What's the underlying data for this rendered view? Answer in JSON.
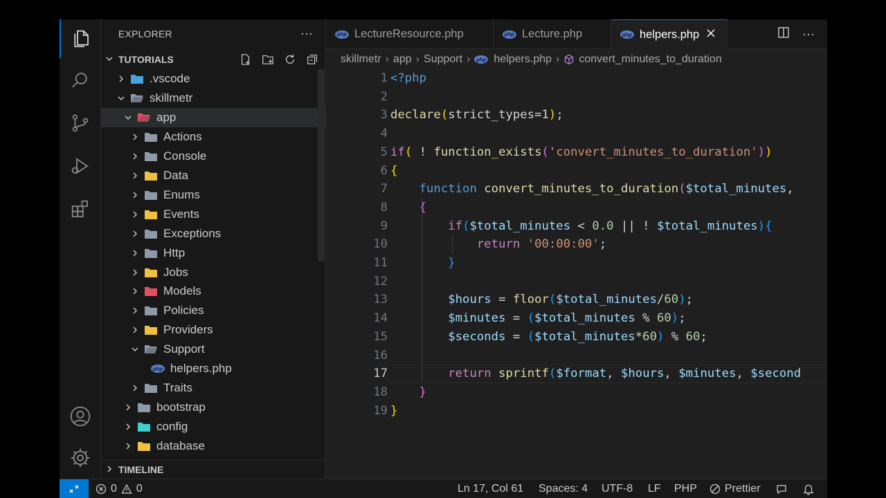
{
  "explorer": {
    "title": "EXPLORER",
    "more": "···",
    "section": "TUTORIALS",
    "timeline": "TIMELINE"
  },
  "tree": [
    {
      "label": ".vscode",
      "depth": 1,
      "open": false,
      "icon": "vscode-folder-icon",
      "color": "#4aa3df"
    },
    {
      "label": "skillmetr",
      "depth": 1,
      "open": true,
      "icon": "folder-open-icon",
      "color": "#8e9aa8"
    },
    {
      "label": "app",
      "depth": 2,
      "open": true,
      "icon": "app-folder-icon",
      "color": "#e05260",
      "selected": true
    },
    {
      "label": "Actions",
      "depth": 3,
      "open": false,
      "icon": "folder-icon",
      "color": "#8e9aa8"
    },
    {
      "label": "Console",
      "depth": 3,
      "open": false,
      "icon": "folder-icon",
      "color": "#8e9aa8"
    },
    {
      "label": "Data",
      "depth": 3,
      "open": false,
      "icon": "data-folder-icon",
      "color": "#f0c040"
    },
    {
      "label": "Enums",
      "depth": 3,
      "open": false,
      "icon": "folder-icon",
      "color": "#8e9aa8"
    },
    {
      "label": "Events",
      "depth": 3,
      "open": false,
      "icon": "events-folder-icon",
      "color": "#f0c040"
    },
    {
      "label": "Exceptions",
      "depth": 3,
      "open": false,
      "icon": "folder-icon",
      "color": "#8e9aa8"
    },
    {
      "label": "Http",
      "depth": 3,
      "open": false,
      "icon": "folder-icon",
      "color": "#8e9aa8"
    },
    {
      "label": "Jobs",
      "depth": 3,
      "open": false,
      "icon": "jobs-folder-icon",
      "color": "#f0c040"
    },
    {
      "label": "Models",
      "depth": 3,
      "open": false,
      "icon": "models-folder-icon",
      "color": "#e05260"
    },
    {
      "label": "Policies",
      "depth": 3,
      "open": false,
      "icon": "folder-icon",
      "color": "#8e9aa8"
    },
    {
      "label": "Providers",
      "depth": 3,
      "open": false,
      "icon": "providers-folder-icon",
      "color": "#f0c040"
    },
    {
      "label": "Support",
      "depth": 3,
      "open": true,
      "icon": "folder-open-icon",
      "color": "#8e9aa8"
    },
    {
      "label": "helpers.php",
      "depth": 4,
      "file": true,
      "icon": "php-file-icon",
      "color": "#5a7fc4"
    },
    {
      "label": "Traits",
      "depth": 3,
      "open": false,
      "icon": "folder-icon",
      "color": "#8e9aa8"
    },
    {
      "label": "bootstrap",
      "depth": 2,
      "open": false,
      "icon": "folder-icon",
      "color": "#8e9aa8"
    },
    {
      "label": "config",
      "depth": 2,
      "open": false,
      "icon": "config-folder-icon",
      "color": "#3ecfcf"
    },
    {
      "label": "database",
      "depth": 2,
      "open": false,
      "icon": "database-folder-icon",
      "color": "#f0c040"
    }
  ],
  "tabs": [
    {
      "label": "LectureResource.php",
      "active": false
    },
    {
      "label": "Lecture.php",
      "active": false
    },
    {
      "label": "helpers.php",
      "active": true
    }
  ],
  "breadcrumbs": [
    "skillmetr",
    "app",
    "Support",
    "helpers.php",
    "convert_minutes_to_duration"
  ],
  "code": [
    [
      [
        "tag",
        "<?php"
      ]
    ],
    [],
    [
      [
        "f",
        "declare"
      ],
      [
        "b1",
        "("
      ],
      [
        "t",
        "strict_types=1"
      ],
      [
        "b1",
        ")"
      ],
      [
        "t",
        ";"
      ]
    ],
    [],
    [
      [
        "k",
        "if"
      ],
      [
        "b1",
        "("
      ],
      [
        "t",
        " ! "
      ],
      [
        "f",
        "function_exists"
      ],
      [
        "b2",
        "("
      ],
      [
        "s",
        "'convert_minutes_to_duration'"
      ],
      [
        "b2",
        ")"
      ],
      [
        "b1",
        ")"
      ]
    ],
    [
      [
        "b1",
        "{"
      ]
    ],
    [
      [
        "t",
        "    "
      ],
      [
        "kb",
        "function"
      ],
      [
        "t",
        " "
      ],
      [
        "f",
        "convert_minutes_to_duration"
      ],
      [
        "b2",
        "("
      ],
      [
        "v",
        "$total_minutes"
      ],
      [
        "t",
        ","
      ]
    ],
    [
      [
        "t",
        "    "
      ],
      [
        "b2",
        "{"
      ]
    ],
    [
      [
        "t",
        "        "
      ],
      [
        "k",
        "if"
      ],
      [
        "b3",
        "("
      ],
      [
        "v",
        "$total_minutes"
      ],
      [
        "t",
        " < "
      ],
      [
        "n",
        "0.0"
      ],
      [
        "t",
        " || ! "
      ],
      [
        "v",
        "$total_minutes"
      ],
      [
        "b3",
        ")"
      ],
      [
        "b3",
        "{"
      ]
    ],
    [
      [
        "t",
        "            "
      ],
      [
        "k",
        "return"
      ],
      [
        "t",
        " "
      ],
      [
        "s",
        "'00:00:00'"
      ],
      [
        "t",
        ";"
      ]
    ],
    [
      [
        "t",
        "        "
      ],
      [
        "b3",
        "}"
      ]
    ],
    [],
    [
      [
        "t",
        "        "
      ],
      [
        "v",
        "$hours"
      ],
      [
        "t",
        " = "
      ],
      [
        "f",
        "floor"
      ],
      [
        "b3",
        "("
      ],
      [
        "v",
        "$total_minutes"
      ],
      [
        "t",
        "/"
      ],
      [
        "n",
        "60"
      ],
      [
        "b3",
        ")"
      ],
      [
        "t",
        ";"
      ]
    ],
    [
      [
        "t",
        "        "
      ],
      [
        "v",
        "$minutes"
      ],
      [
        "t",
        " = "
      ],
      [
        "b3",
        "("
      ],
      [
        "v",
        "$total_minutes"
      ],
      [
        "t",
        " % "
      ],
      [
        "n",
        "60"
      ],
      [
        "b3",
        ")"
      ],
      [
        "t",
        ";"
      ]
    ],
    [
      [
        "t",
        "        "
      ],
      [
        "v",
        "$seconds"
      ],
      [
        "t",
        " = "
      ],
      [
        "b3",
        "("
      ],
      [
        "v",
        "$total_minutes"
      ],
      [
        "t",
        "*"
      ],
      [
        "n",
        "60"
      ],
      [
        "b3",
        ")"
      ],
      [
        "t",
        " % "
      ],
      [
        "n",
        "60"
      ],
      [
        "t",
        ";"
      ]
    ],
    [],
    [
      [
        "t",
        "        "
      ],
      [
        "k",
        "return"
      ],
      [
        "t",
        " "
      ],
      [
        "f",
        "sprintf"
      ],
      [
        "b3",
        "("
      ],
      [
        "v",
        "$format"
      ],
      [
        "t",
        ", "
      ],
      [
        "v",
        "$hours"
      ],
      [
        "t",
        ", "
      ],
      [
        "v",
        "$minutes"
      ],
      [
        "t",
        ", "
      ],
      [
        "v",
        "$second"
      ]
    ],
    [
      [
        "t",
        "    "
      ],
      [
        "b2",
        "}"
      ]
    ],
    [
      [
        "b1",
        "}"
      ]
    ]
  ],
  "current_line": 17,
  "status": {
    "errors": "0",
    "warnings": "0",
    "position": "Ln 17, Col 61",
    "spaces": "Spaces: 4",
    "encoding": "UTF-8",
    "eol": "LF",
    "language": "PHP",
    "formatter": "Prettier"
  },
  "colors": {
    "accent": "#0078d4",
    "background": "#1f1f1f",
    "sidebar": "#181818"
  }
}
